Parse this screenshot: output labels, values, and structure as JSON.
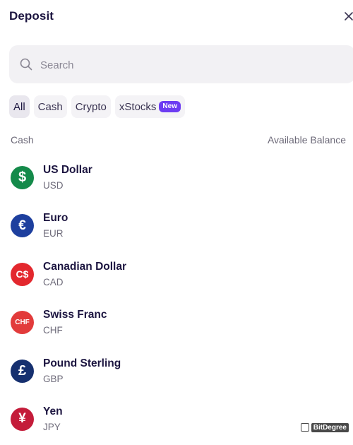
{
  "header": {
    "title": "Deposit",
    "close_icon": "close-icon"
  },
  "search": {
    "placeholder": "Search",
    "value": ""
  },
  "filters": [
    {
      "label": "All",
      "active": true
    },
    {
      "label": "Cash",
      "active": false
    },
    {
      "label": "Crypto",
      "active": false
    },
    {
      "label": "xStocks",
      "active": false,
      "badge": "New"
    }
  ],
  "section": {
    "left_label": "Cash",
    "right_label": "Available Balance"
  },
  "currencies": [
    {
      "name": "US Dollar",
      "code": "USD",
      "symbol": "$",
      "color": "#148a4a"
    },
    {
      "name": "Euro",
      "code": "EUR",
      "symbol": "€",
      "color": "#1d3f9e"
    },
    {
      "name": "Canadian Dollar",
      "code": "CAD",
      "symbol": "C$",
      "color": "#e3282e"
    },
    {
      "name": "Swiss Franc",
      "code": "CHF",
      "symbol": "CHF",
      "color": "#e23b3b"
    },
    {
      "name": "Pound Sterling",
      "code": "GBP",
      "symbol": "£",
      "color": "#16306f"
    },
    {
      "name": "Yen",
      "code": "JPY",
      "symbol": "¥",
      "color": "#c41c3a"
    }
  ],
  "watermark": {
    "text": "BitDegree"
  }
}
